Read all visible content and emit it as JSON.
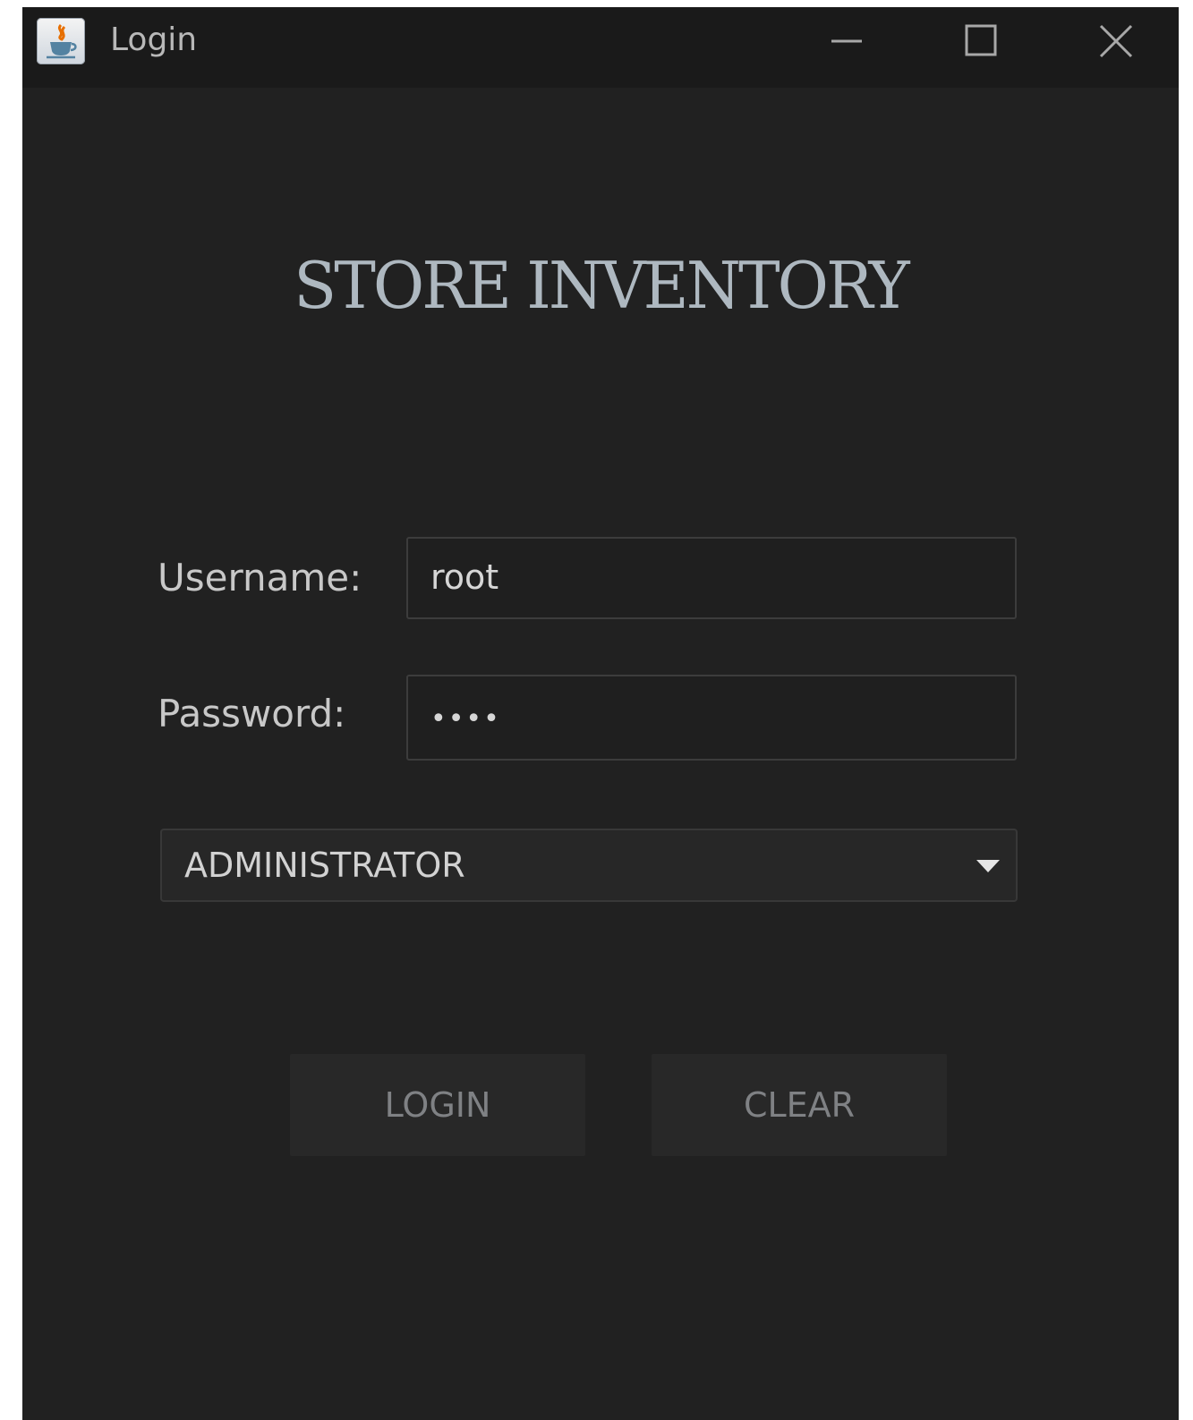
{
  "window": {
    "title": "Login",
    "icon": "java-cup-icon",
    "controls": [
      "minimize-icon",
      "maximize-icon",
      "close-icon"
    ]
  },
  "main": {
    "heading": "STORE INVENTORY",
    "username": {
      "label": "Username:",
      "value": "root"
    },
    "password": {
      "label": "Password:",
      "masked_value": "••••"
    },
    "role_select": {
      "selected": "ADMINISTRATOR"
    },
    "buttons": {
      "login": "LOGIN",
      "clear": "CLEAR"
    }
  },
  "colors": {
    "background": "#212121",
    "titlebar": "#1a1a1a",
    "heading": "#aeb8c0",
    "text": "#c8c8c8",
    "button_background": "#282828",
    "button_text": "#7f8184"
  }
}
